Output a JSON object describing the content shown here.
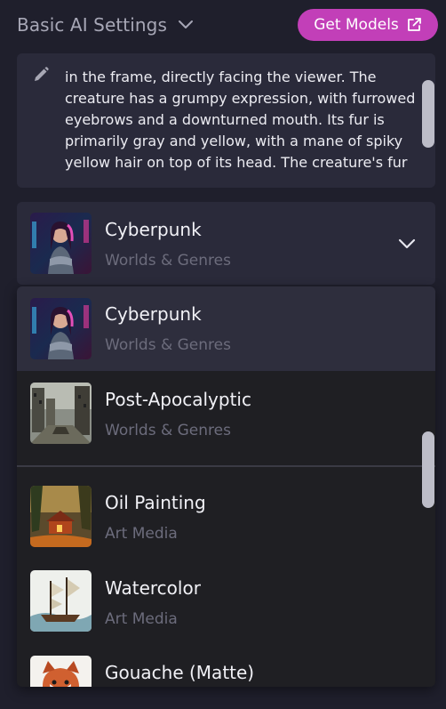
{
  "header": {
    "title": "Basic AI Settings",
    "chevron_icon": "chevron-down-icon",
    "get_models_label": "Get Models",
    "get_models_icon": "external-link-icon",
    "accent_color": "#c23fb8"
  },
  "prompt": {
    "icon": "pencil-icon",
    "text": "in the frame, directly facing the viewer. The\ncreature has a grumpy expression, with furrowed\neyebrows and a downturned mouth. Its fur is\nprimarily gray and yellow, with a mane of spiky\nyellow hair on top of its head. The creature's fur"
  },
  "selector": {
    "name": "Cyberpunk",
    "category": "Worlds & Genres",
    "chevron_icon": "chevron-down-icon"
  },
  "dropdown": {
    "items": [
      {
        "name": "Cyberpunk",
        "category": "Worlds & Genres",
        "selected": true
      },
      {
        "name": "Post-Apocalyptic",
        "category": "Worlds & Genres",
        "selected": false
      },
      {
        "name": "Oil Painting",
        "category": "Art Media",
        "selected": false
      },
      {
        "name": "Watercolor",
        "category": "Art Media",
        "selected": false
      },
      {
        "name": "Gouache (Matte)",
        "category": "",
        "selected": false
      }
    ]
  }
}
